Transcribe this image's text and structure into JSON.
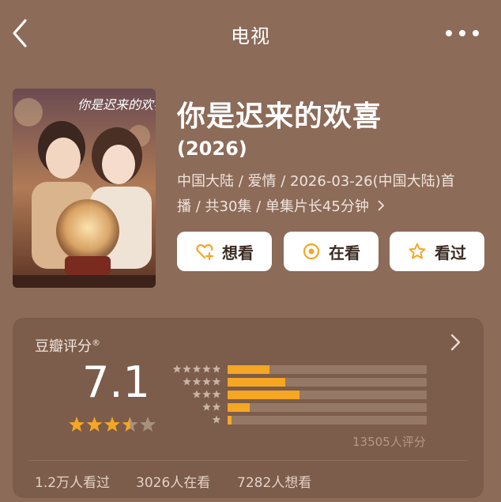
{
  "nav": {
    "title": "电视"
  },
  "show": {
    "title": "你是迟来的欢喜",
    "year": "(2026)",
    "meta_line1": "中国大陆 / 爱情 / 2026-03-26(中国大陆)首",
    "meta_line2": "播 / 共30集 / 单集片长45分钟",
    "poster_text": "你是迟来的欢喜"
  },
  "actions": {
    "want": "想看",
    "watching": "在看",
    "watched": "看过"
  },
  "rating": {
    "label": "豆瓣评分",
    "mark": "®",
    "score": "7.1",
    "stars": 3.5,
    "count_text": "13505人评分",
    "distribution": [
      {
        "stars": 5,
        "fraction": 0.21
      },
      {
        "stars": 4,
        "fraction": 0.29
      },
      {
        "stars": 3,
        "fraction": 0.36
      },
      {
        "stars": 2,
        "fraction": 0.11
      },
      {
        "stars": 1,
        "fraction": 0.02
      }
    ]
  },
  "stats": {
    "watched": "1.2万人看过",
    "watching": "3026人在看",
    "want": "7282人想看"
  },
  "colors": {
    "background": "#8c6b58",
    "card": "#7c5c4a",
    "accent": "#f5a623",
    "button_text": "#3a2a22"
  }
}
